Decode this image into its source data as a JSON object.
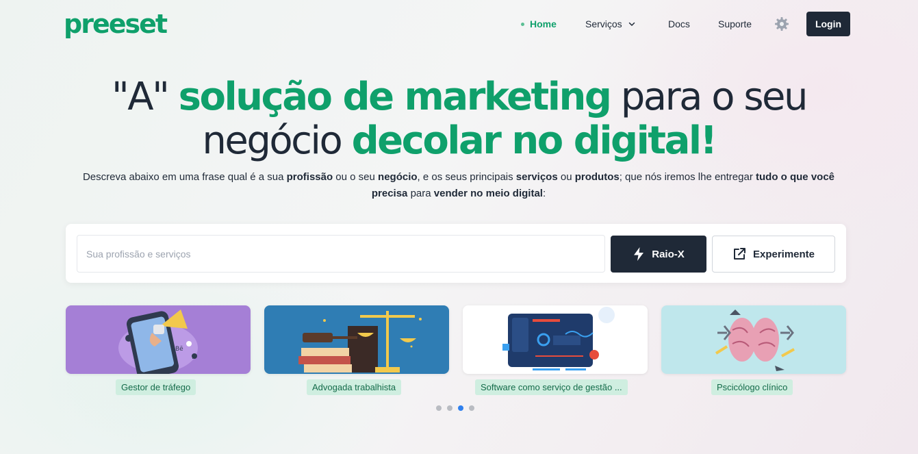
{
  "brand": {
    "logo_text": "preeset",
    "color": "#0fa06b"
  },
  "nav": {
    "home": "Home",
    "servicos": "Serviços",
    "docs": "Docs",
    "suporte": "Suporte",
    "settings_icon": "gear-icon",
    "login": "Login"
  },
  "hero": {
    "title_part1": "\"A\" ",
    "title_part2": "solução de marketing",
    "title_part3": " para o seu",
    "title_part4": "negócio ",
    "title_part5": "decolar no digital!",
    "sub": {
      "t1": "Descreva abaixo em uma frase qual é a sua ",
      "b1": "profissão",
      "t2": " ou o seu ",
      "b2": "negócio",
      "t3": ", e os seus principais ",
      "b3": "serviços",
      "t4": " ou ",
      "b4": "produtos",
      "t5": "; que nós iremos lhe entregar ",
      "b5": "tudo o que você precisa",
      "t6": " para ",
      "b6": "vender no meio digital",
      "t7": ":"
    }
  },
  "search": {
    "placeholder": "Sua profissão e serviços",
    "value": "",
    "raio_x": "Raio-X",
    "experimente": "Experimente"
  },
  "carousel": {
    "cards": [
      {
        "label": "Gestor de tráfego",
        "bg": "#a57fd6"
      },
      {
        "label": "Advogada trabalhista",
        "bg": "#2f7db4"
      },
      {
        "label": "Software como serviço de gestão ...",
        "bg": "#ffffff"
      },
      {
        "label": "Pscicólogo clínico",
        "bg": "#bfe7ec"
      }
    ],
    "dots_total": 4,
    "active_dot": 3
  }
}
